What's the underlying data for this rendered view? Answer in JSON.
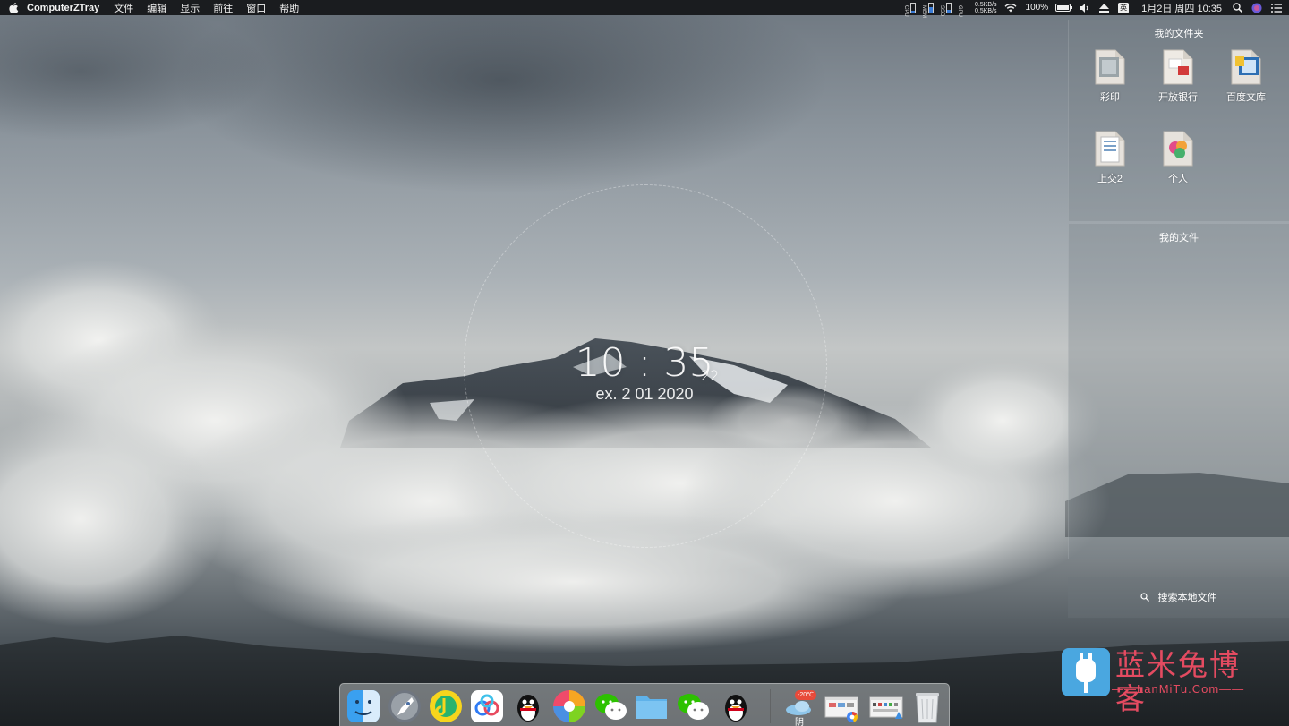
{
  "menubar": {
    "app_name": "ComputerZTray",
    "menus": [
      "文件",
      "编辑",
      "显示",
      "前往",
      "窗口",
      "帮助"
    ],
    "stats": [
      {
        "label": "CPU",
        "level": 0.15
      },
      {
        "label": "MEM",
        "level": 0.55
      },
      {
        "label": "SSD",
        "level": 0.3
      },
      {
        "label": "GPU",
        "level": 0.1
      }
    ],
    "net_up": "0.5KB/s",
    "net_down": "0.5KB/s",
    "battery_percent": "100%",
    "ime_label": "英",
    "datetime": "1月2日 周四 10:35"
  },
  "desktop_clock": {
    "time": "10 : 35",
    "seconds": "22",
    "date": "ex. 2 01 2020"
  },
  "folders_panel": {
    "title": "我的文件夹",
    "items": [
      {
        "label": "彩印",
        "icon": "folder-icon"
      },
      {
        "label": "开放银行",
        "icon": "folder-icon"
      },
      {
        "label": "百度文库",
        "icon": "folder-icon"
      },
      {
        "label": "上交2",
        "icon": "folder-icon"
      },
      {
        "label": "个人",
        "icon": "folder-icon"
      }
    ]
  },
  "files_panel": {
    "title": "我的文件"
  },
  "search": {
    "placeholder": "搜索本地文件"
  },
  "watermark": {
    "title": "蓝米兔博客",
    "subtitle": "——LanMiTu.Com——"
  },
  "dock": {
    "weather_temp": "-20℃",
    "weather_label": "阴",
    "apps": [
      "Finder",
      "Launchpad",
      "QQ音乐",
      "百度网盘",
      "QQ",
      "Pinwheel",
      "微信",
      "Folder",
      "微信",
      "QQ"
    ]
  },
  "colors": {
    "menubar_bg": "#1a1c1f",
    "watermark": "#e44b61",
    "accent_blue": "#3a7bd5"
  }
}
